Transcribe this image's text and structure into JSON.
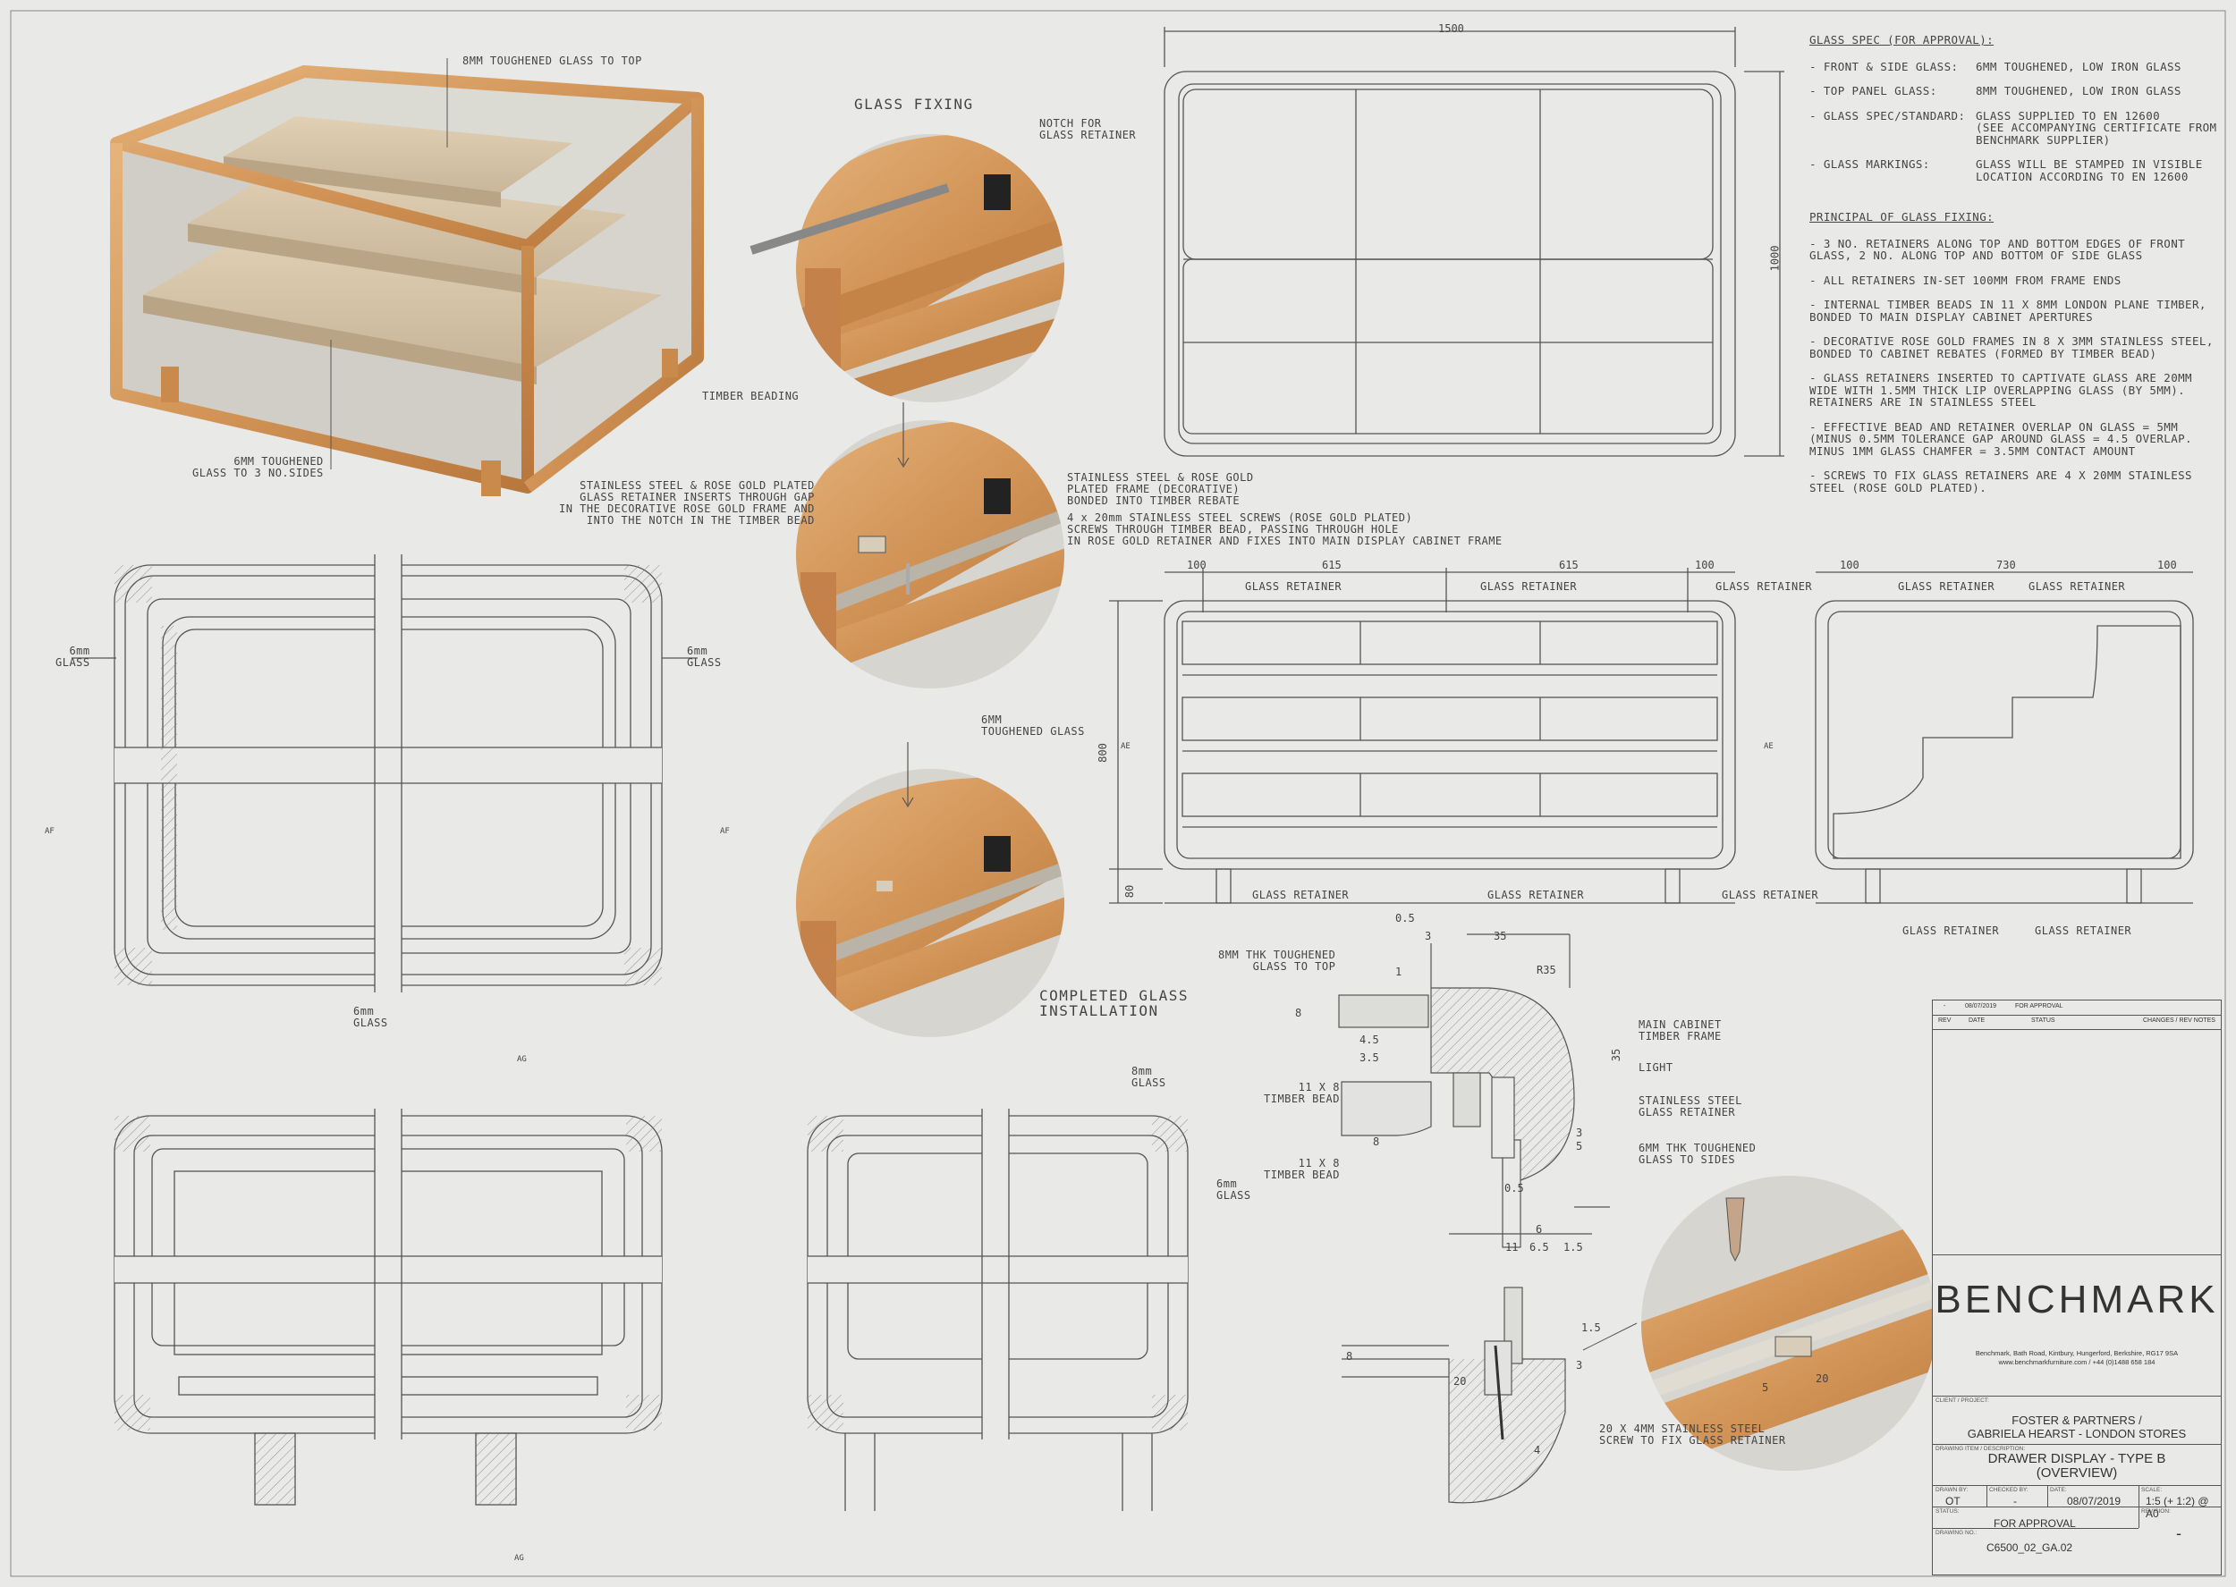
{
  "top_left": {
    "label_8mm_top": "8MM TOUGHENED GLASS TO TOP",
    "label_6mm_sides": "6MM TOUGHENED\nGLASS TO 3 NO.SIDES"
  },
  "glass_fixing": {
    "title": "GLASS FIXING",
    "notch": "NOTCH FOR\nGLASS RETAINER",
    "timber_beading": "TIMBER BEADING",
    "ss_retainer": "STAINLESS STEEL & ROSE GOLD PLATED\nGLASS RETAINER INSERTS THROUGH GAP\nIN THE DECORATIVE ROSE GOLD FRAME AND\nINTO THE NOTCH IN THE TIMBER BEAD",
    "ss_frame": "STAINLESS STEEL & ROSE GOLD\nPLATED FRAME (DECORATIVE)\nBONDED INTO TIMBER REBATE",
    "screws": "4 x 20mm STAINLESS STEEL SCREWS (ROSE GOLD PLATED)\nSCREWS THROUGH TIMBER BEAD, PASSING THROUGH HOLE\nIN ROSE GOLD RETAINER AND FIXES INTO MAIN DISPLAY CABINET FRAME",
    "glass_6mm": "6MM\nTOUGHENED GLASS",
    "completed": "COMPLETED GLASS\nINSTALLATION"
  },
  "plan": {
    "glass_left": "6mm\nGLASS",
    "glass_right": "6mm\nGLASS",
    "glass_bottom": "6mm\nGLASS",
    "section_af": "AF",
    "section_ag": "AG"
  },
  "elev_bottom": {
    "glass_8mm": "8mm\nGLASS",
    "glass_6mm": "6mm\nGLASS",
    "section_ag": "AG"
  },
  "top_plan": {
    "width": "1500",
    "height": "1000"
  },
  "front_elev": {
    "dims_top": [
      "100",
      "615",
      "615",
      "100"
    ],
    "height": "800",
    "leg": "80",
    "section": "AE",
    "retainer": "GLASS RETAINER"
  },
  "side_elev": {
    "dims_top": [
      "100",
      "730",
      "100"
    ],
    "retainer": "GLASS RETAINER"
  },
  "detail": {
    "glass_8mm": "8MM THK TOUGHENED\nGLASS TO TOP",
    "main_frame": "MAIN CABINET\nTIMBER FRAME",
    "light": "LIGHT",
    "ss_retainer": "STAINLESS STEEL\nGLASS RETAINER",
    "glass_6mm": "6MM THK TOUGHENED\nGLASS TO SIDES",
    "bead": "11 X 8\nTIMBER BEAD",
    "screw": "20 X 4MM STAINLESS STEEL\nSCREW TO FIX GLASS RETAINER",
    "dims": [
      "0.5",
      "3",
      "35",
      "R35",
      "1",
      "8",
      "4.5",
      "3.5",
      "35",
      "5",
      "3",
      "8",
      "0.5",
      "6",
      "11",
      "6.5",
      "1.5",
      "1.5",
      "8",
      "20",
      "3",
      "4",
      "20",
      "5"
    ]
  },
  "spec": {
    "heading1": "GLASS SPEC (FOR APPROVAL):",
    "rows": [
      {
        "k": "- FRONT & SIDE GLASS:",
        "v": "6MM TOUGHENED, LOW IRON GLASS"
      },
      {
        "k": "- TOP PANEL GLASS:",
        "v": "8MM TOUGHENED, LOW IRON GLASS"
      },
      {
        "k": "- GLASS SPEC/STANDARD:",
        "v": "GLASS SUPPLIED TO EN 12600\n(SEE ACCOMPANYING CERTIFICATE FROM\nBENCHMARK SUPPLIER)"
      },
      {
        "k": "- GLASS MARKINGS:",
        "v": "GLASS WILL BE STAMPED IN VISIBLE\nLOCATION ACCORDING TO EN 12600"
      }
    ],
    "heading2": "PRINCIPAL OF GLASS FIXING:",
    "paras": [
      "- 3 NO. RETAINERS ALONG TOP AND BOTTOM EDGES OF FRONT\nGLASS, 2 NO. ALONG TOP AND BOTTOM OF SIDE GLASS",
      "- ALL RETAINERS IN-SET 100MM FROM FRAME ENDS",
      "- INTERNAL TIMBER BEADS IN 11 X 8MM LONDON PLANE TIMBER,\nBONDED TO MAIN DISPLAY CABINET APERTURES",
      "- DECORATIVE ROSE GOLD FRAMES IN 8 X 3MM STAINLESS STEEL,\nBONDED TO CABINET REBATES (FORMED BY TIMBER BEAD)",
      "- GLASS RETAINERS INSERTED TO CAPTIVATE GLASS ARE 20MM\nWIDE WITH 1.5MM THICK LIP OVERLAPPING GLASS (BY 5MM).\nRETAINERS ARE IN STAINLESS STEEL",
      "- EFFECTIVE BEAD AND RETAINER OVERLAP ON GLASS = 5MM\n(MINUS 0.5MM TOLERANCE GAP AROUND GLASS = 4.5 OVERLAP.\nMINUS 1MM GLASS CHAMFER = 3.5MM CONTACT AMOUNT",
      "- SCREWS TO FIX GLASS RETAINERS ARE 4 X 20MM STAINLESS\nSTEEL (ROSE GOLD PLATED)."
    ]
  },
  "title_block": {
    "rev_row": [
      "-",
      "08/07/2019",
      "FOR APPROVAL"
    ],
    "rev_headers": [
      "REV",
      "DATE",
      "STATUS",
      "CHANGES / REV NOTES"
    ],
    "logo": "BENCHMARK",
    "address": "Benchmark, Bath Road, Kintbury, Hungerford, Berkshire, RG17 9SA\nwww.benchmarkfurniture.com / +44 (0)1488 658 184",
    "client_label": "CLIENT / PROJECT:",
    "client": "FOSTER & PARTNERS /\nGABRIELA HEARST - LONDON STORES",
    "desc_label": "DRAWING ITEM / DESCRIPTION:",
    "desc": "DRAWER DISPLAY - TYPE B\n(OVERVIEW)",
    "drawn_label": "DRAWN BY:",
    "drawn": "OT",
    "checked_label": "CHECKED BY:",
    "checked": "-",
    "date_label": "DATE:",
    "date": "08/07/2019",
    "scale_label": "SCALE:",
    "scale": "1:5 (+ 1:2) @ A0",
    "status_label": "STATUS:",
    "status": "FOR APPROVAL",
    "revision_label": "REVISION:",
    "revision": "-",
    "drawing_no_label": "DRAWING NO.:",
    "drawing_no": "C6500_02_GA.02"
  },
  "colors": {
    "timber": "#d9a36a",
    "timber_dark": "#b9793c",
    "glass": "#c9c9c2",
    "line": "#555555",
    "paper": "#e9e9e7"
  }
}
